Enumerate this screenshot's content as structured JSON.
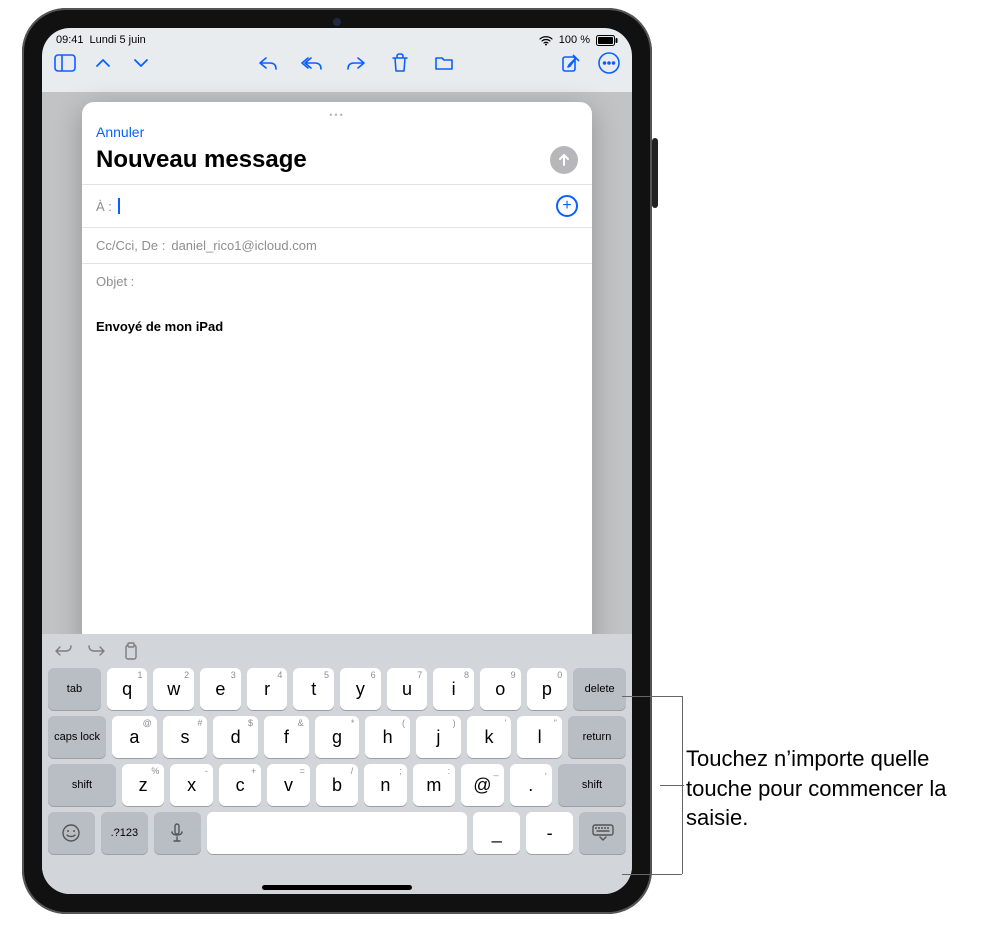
{
  "status": {
    "time": "09:41",
    "date": "Lundi 5 juin",
    "battery_pct": "100 %"
  },
  "compose": {
    "cancel": "Annuler",
    "title": "Nouveau message",
    "to_label": "À :",
    "cc_label": "Cc/Cci, De :",
    "cc_value": "daniel_rico1@icloud.com",
    "subject_label": "Objet :",
    "signature": "Envoyé de mon iPad"
  },
  "keyboard": {
    "row1": [
      {
        "main": "q",
        "sup": "1"
      },
      {
        "main": "w",
        "sup": "2"
      },
      {
        "main": "e",
        "sup": "3"
      },
      {
        "main": "r",
        "sup": "4"
      },
      {
        "main": "t",
        "sup": "5"
      },
      {
        "main": "y",
        "sup": "6"
      },
      {
        "main": "u",
        "sup": "7"
      },
      {
        "main": "i",
        "sup": "8"
      },
      {
        "main": "o",
        "sup": "9"
      },
      {
        "main": "p",
        "sup": "0"
      }
    ],
    "row2": [
      {
        "main": "a",
        "sup": "@"
      },
      {
        "main": "s",
        "sup": "#"
      },
      {
        "main": "d",
        "sup": "$"
      },
      {
        "main": "f",
        "sup": "&"
      },
      {
        "main": "g",
        "sup": "*"
      },
      {
        "main": "h",
        "sup": "("
      },
      {
        "main": "j",
        "sup": ")"
      },
      {
        "main": "k",
        "sup": "'"
      },
      {
        "main": "l",
        "sup": "\""
      }
    ],
    "row3": [
      {
        "main": "z",
        "sup": "%"
      },
      {
        "main": "x",
        "sup": "-"
      },
      {
        "main": "c",
        "sup": "+"
      },
      {
        "main": "v",
        "sup": "="
      },
      {
        "main": "b",
        "sup": "/"
      },
      {
        "main": "n",
        "sup": ";"
      },
      {
        "main": "m",
        "sup": ":"
      },
      {
        "main": "@",
        "sup": "_"
      },
      {
        "main": ".",
        "sup": ","
      }
    ],
    "tab": "tab",
    "delete": "delete",
    "capslock": "caps lock",
    "return": "return",
    "shift": "shift",
    "numbers": ".?123",
    "underscore": "_",
    "dash": "-"
  },
  "callout": {
    "text": "Touchez n’importe quelle touche pour commencer la saisie."
  }
}
